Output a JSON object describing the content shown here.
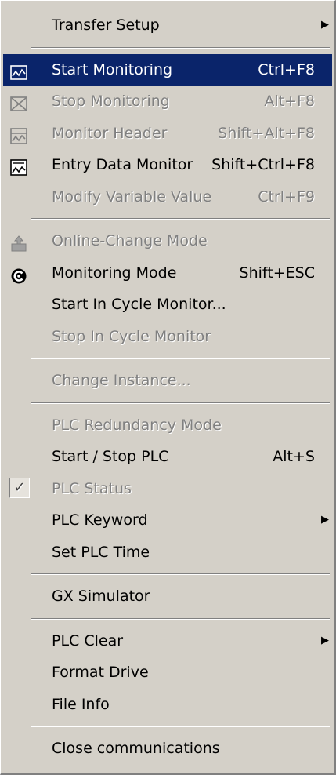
{
  "menu": {
    "items": {
      "transfer_setup": "Transfer Setup",
      "start_monitoring": "Start Monitoring",
      "start_monitoring_shortcut": "Ctrl+F8",
      "stop_monitoring": "Stop Monitoring",
      "stop_monitoring_shortcut": "Alt+F8",
      "monitor_header": "Monitor Header",
      "monitor_header_shortcut": "Shift+Alt+F8",
      "entry_data_monitor": "Entry Data Monitor",
      "entry_data_monitor_shortcut": "Shift+Ctrl+F8",
      "modify_variable_value": "Modify Variable Value",
      "modify_variable_value_shortcut": "Ctrl+F9",
      "online_change_mode": "Online-Change Mode",
      "monitoring_mode": "Monitoring Mode",
      "monitoring_mode_shortcut": "Shift+ESC",
      "start_in_cycle_monitor": "Start In Cycle Monitor...",
      "stop_in_cycle_monitor": "Stop In Cycle Monitor",
      "change_instance": "Change Instance...",
      "plc_redundancy_mode": "PLC Redundancy Mode",
      "start_stop_plc": "Start / Stop PLC",
      "start_stop_plc_shortcut": "Alt+S",
      "plc_status": "PLC Status",
      "plc_keyword": "PLC Keyword",
      "set_plc_time": "Set PLC Time",
      "gx_simulator": "GX Simulator",
      "plc_clear": "PLC Clear",
      "format_drive": "Format Drive",
      "file_info": "File Info",
      "close_communications": "Close communications"
    },
    "submenu_arrow": "▶",
    "check_mark": "✓",
    "colors": {
      "menu_bg": "#d4d0c8",
      "highlight_bg": "#0a246a",
      "disabled_text": "#808080"
    }
  }
}
